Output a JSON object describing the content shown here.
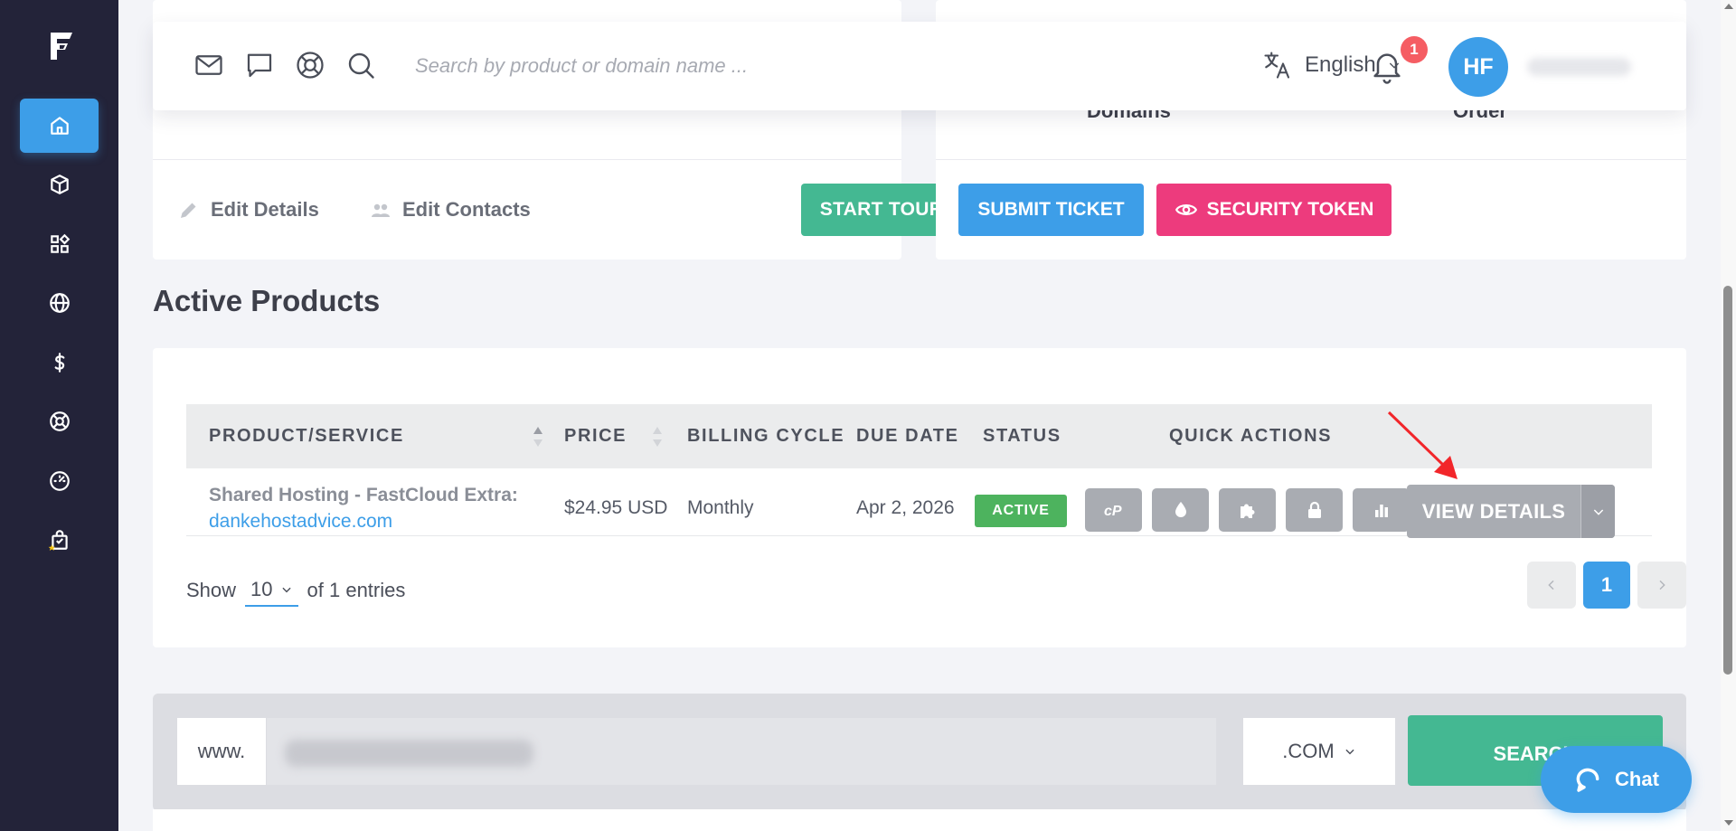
{
  "header": {
    "search_placeholder": "Search by product or domain name ...",
    "language": "English",
    "notification_count": "1",
    "user_initials": "HF"
  },
  "summary": {
    "stat_domains": "Domains",
    "stat_order": "Order",
    "edit_details": "Edit Details",
    "edit_contacts": "Edit Contacts",
    "start_tour": "START TOUR",
    "submit_ticket": "SUBMIT TICKET",
    "security_token": "SECURITY TOKEN"
  },
  "products": {
    "title": "Active Products",
    "columns": {
      "product": "PRODUCT/SERVICE",
      "price": "PRICE",
      "billing": "BILLING CYCLE",
      "due": "DUE DATE",
      "status": "STATUS",
      "actions": "QUICK ACTIONS"
    },
    "rows": [
      {
        "name": "Shared Hosting - FastCloud Extra:",
        "domain": "dankehostadvice.com",
        "price": "$24.95 USD",
        "billing": "Monthly",
        "due": "Apr 2, 2026",
        "status": "ACTIVE",
        "view_details": "VIEW DETAILS"
      }
    ],
    "show_label": "Show",
    "show_value": "10",
    "entries_label": "of 1 entries",
    "page_current": "1"
  },
  "domain_search": {
    "prefix": "www.",
    "tld": ".COM",
    "search_label": "SEARCH"
  },
  "chat": {
    "label": "Chat"
  },
  "colors": {
    "sidebar": "#232339",
    "primary": "#3d9ee8",
    "success": "#44b892",
    "danger": "#ed3b7d",
    "status_active": "#4db35e"
  }
}
